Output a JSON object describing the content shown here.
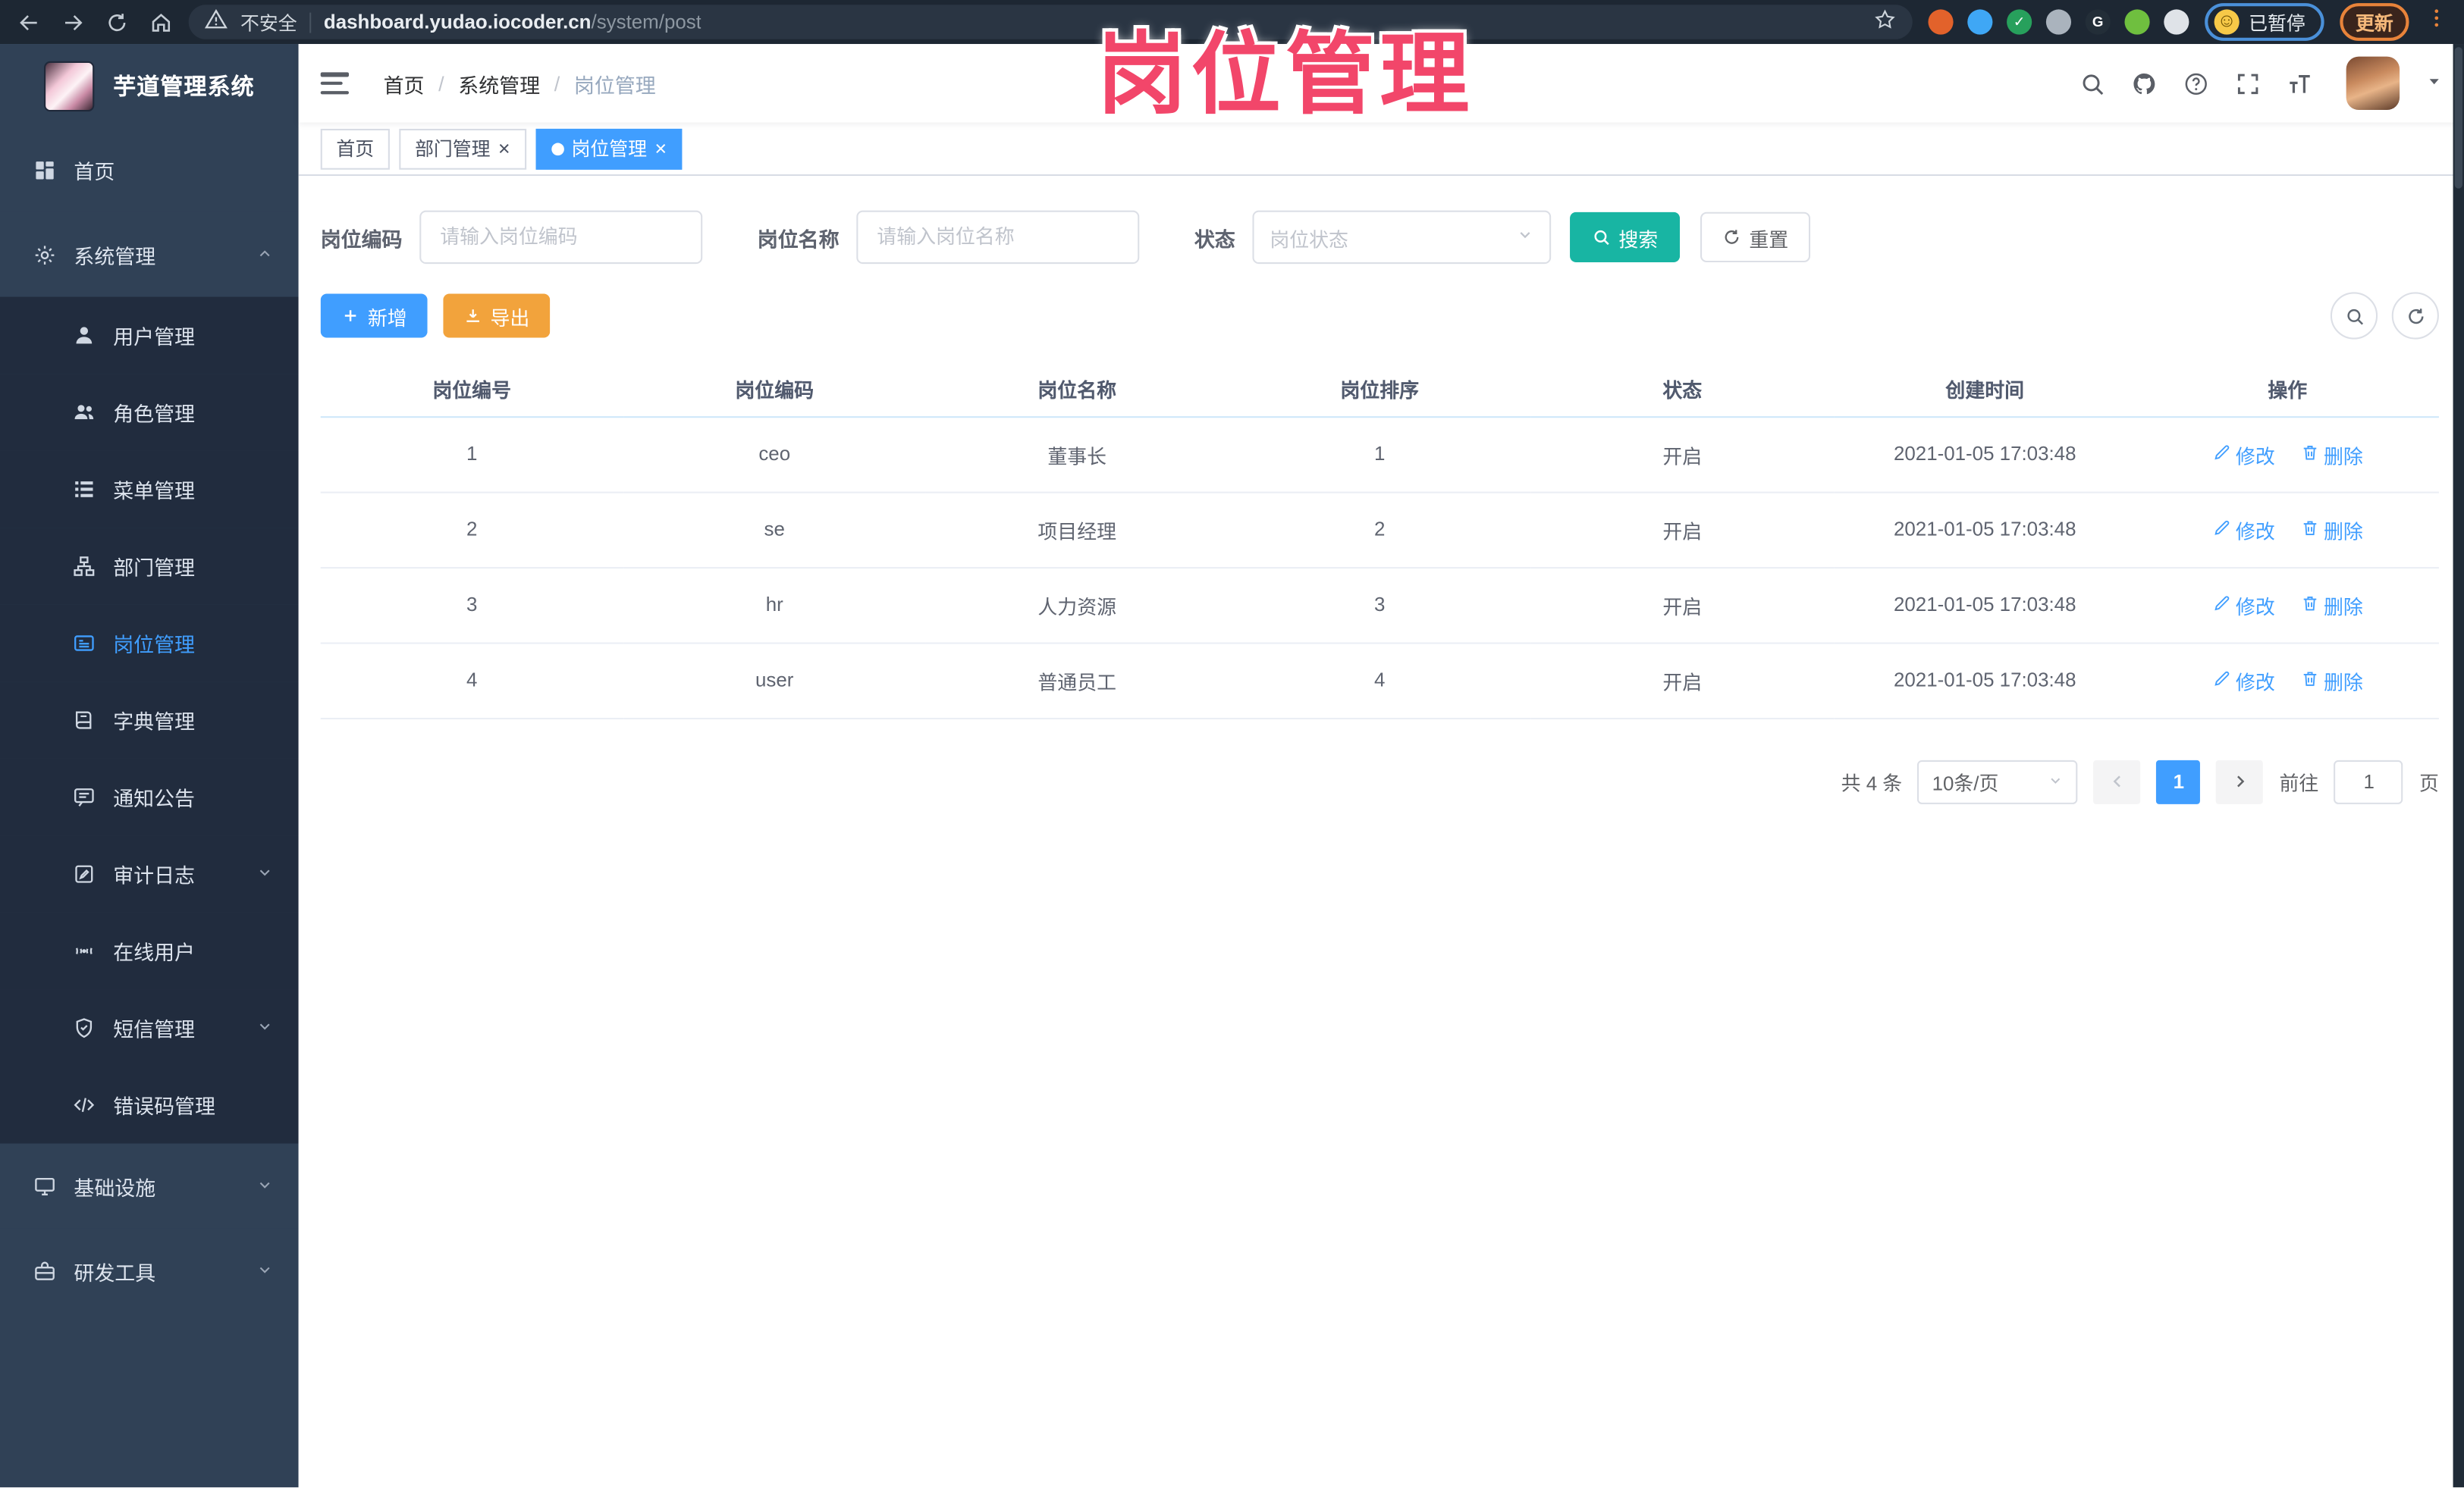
{
  "browser": {
    "security_label": "不安全",
    "url_host": "dashboard.yudao.iocoder.cn",
    "url_path": "/system/post",
    "paused_label": "已暂停",
    "update_label": "更新",
    "extensions": [
      {
        "name": "donut-extension-icon",
        "color": "#e2622b",
        "glyph": ""
      },
      {
        "name": "pin-extension-icon",
        "color": "#3fa7f5",
        "glyph": ""
      },
      {
        "name": "check-extension-icon",
        "color": "#27a05c",
        "glyph": "✓"
      },
      {
        "name": "grid-extension-icon",
        "color": "#aab3bd",
        "glyph": ""
      },
      {
        "name": "terminal-extension-icon",
        "color": "#232e38",
        "glyph": "G"
      },
      {
        "name": "sprout-extension-icon",
        "color": "#6fbf3f",
        "glyph": ""
      },
      {
        "name": "puzzle-extension-icon",
        "color": "#dfe3e8",
        "glyph": ""
      }
    ]
  },
  "annotation": {
    "text": "岗位管理"
  },
  "sidebar": {
    "logo_title": "芋道管理系统",
    "items": [
      {
        "key": "home",
        "label": "首页",
        "icon": "home-icon",
        "level": 1
      },
      {
        "key": "system-management",
        "label": "系统管理",
        "icon": "gear-icon",
        "level": 1,
        "chevron": "up"
      },
      {
        "key": "user-management",
        "label": "用户管理",
        "icon": "user-icon",
        "level": 2
      },
      {
        "key": "role-management",
        "label": "角色管理",
        "icon": "users-icon",
        "level": 2
      },
      {
        "key": "menu-management",
        "label": "菜单管理",
        "icon": "menu-list-icon",
        "level": 2
      },
      {
        "key": "dept-management",
        "label": "部门管理",
        "icon": "org-tree-icon",
        "level": 2
      },
      {
        "key": "post-management",
        "label": "岗位管理",
        "icon": "badge-icon",
        "level": 2,
        "active": true
      },
      {
        "key": "dict-management",
        "label": "字典管理",
        "icon": "book-icon",
        "level": 2
      },
      {
        "key": "notice-management",
        "label": "通知公告",
        "icon": "notice-icon",
        "level": 2
      },
      {
        "key": "audit-log",
        "label": "审计日志",
        "icon": "audit-icon",
        "level": 2,
        "chevron": "down"
      },
      {
        "key": "online-users",
        "label": "在线用户",
        "icon": "online-icon",
        "level": 2
      },
      {
        "key": "sms-management",
        "label": "短信管理",
        "icon": "shield-icon",
        "level": 2,
        "chevron": "down"
      },
      {
        "key": "error-code-management",
        "label": "错误码管理",
        "icon": "code-icon",
        "level": 2
      },
      {
        "key": "infrastructure",
        "label": "基础设施",
        "icon": "infra-icon",
        "level": 1,
        "chevron": "down"
      },
      {
        "key": "dev-tools",
        "label": "研发工具",
        "icon": "toolbox-icon",
        "level": 1,
        "chevron": "down"
      }
    ]
  },
  "breadcrumb": {
    "items": [
      "首页",
      "系统管理",
      "岗位管理"
    ]
  },
  "tabs": [
    {
      "key": "home",
      "label": "首页",
      "closable": false,
      "active": false
    },
    {
      "key": "dept-management",
      "label": "部门管理",
      "closable": true,
      "active": false
    },
    {
      "key": "post-management",
      "label": "岗位管理",
      "closable": true,
      "active": true
    }
  ],
  "filters": {
    "code_label": "岗位编码",
    "code_placeholder": "请输入岗位编码",
    "name_label": "岗位名称",
    "name_placeholder": "请输入岗位名称",
    "status_label": "状态",
    "status_placeholder": "岗位状态",
    "search_label": "搜索",
    "reset_label": "重置"
  },
  "toolbar": {
    "add_label": "新增",
    "export_label": "导出"
  },
  "table": {
    "headers": [
      "岗位编号",
      "岗位编码",
      "岗位名称",
      "岗位排序",
      "状态",
      "创建时间",
      "操作"
    ],
    "field_order": [
      "id",
      "code",
      "name",
      "sort",
      "status",
      "created"
    ],
    "rows": [
      {
        "id": "1",
        "code": "ceo",
        "name": "董事长",
        "sort": "1",
        "status": "开启",
        "created": "2021-01-05 17:03:48"
      },
      {
        "id": "2",
        "code": "se",
        "name": "项目经理",
        "sort": "2",
        "status": "开启",
        "created": "2021-01-05 17:03:48"
      },
      {
        "id": "3",
        "code": "hr",
        "name": "人力资源",
        "sort": "3",
        "status": "开启",
        "created": "2021-01-05 17:03:48"
      },
      {
        "id": "4",
        "code": "user",
        "name": "普通员工",
        "sort": "4",
        "status": "开启",
        "created": "2021-01-05 17:03:48"
      }
    ],
    "edit_label": "修改",
    "delete_label": "删除"
  },
  "pagination": {
    "total_text": "共 4 条",
    "page_size_text": "10条/页",
    "current_page": "1",
    "goto_prefix": "前往",
    "goto_value": "1",
    "goto_suffix": "页"
  },
  "colors": {
    "primary": "#409eff",
    "search_teal": "#18b5a3",
    "export_orange": "#f2a33c",
    "sidebar_bg": "#304156",
    "submenu_bg": "#212c3e",
    "annotation_pink": "#f2466a",
    "browser_bar": "#1d2733"
  }
}
